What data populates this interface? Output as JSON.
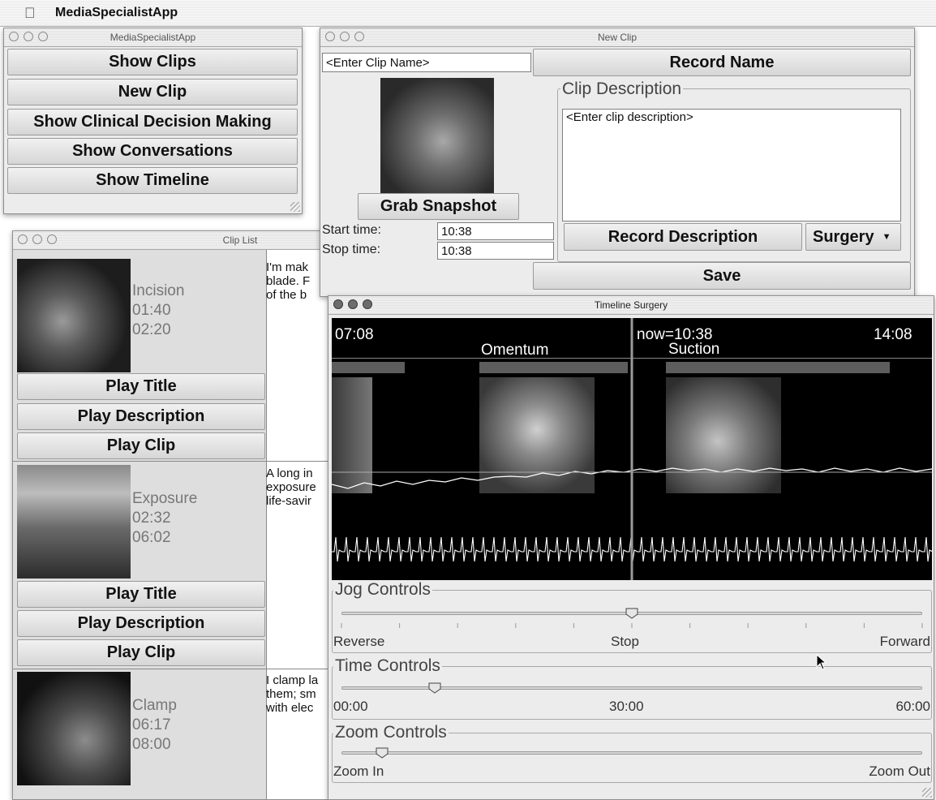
{
  "menubar": {
    "app_name": "MediaSpecialistApp"
  },
  "main_window": {
    "title": "MediaSpecialistApp",
    "buttons": [
      "Show Clips",
      "New Clip",
      "Show Clinical Decision Making",
      "Show Conversations",
      "Show Timeline"
    ]
  },
  "new_clip": {
    "title": "New Clip",
    "name_value": "<Enter Clip Name>",
    "record_name_label": "Record Name",
    "description_group_label": "Clip Description",
    "description_value": "<Enter clip description>",
    "grab_snapshot_label": "Grab Snapshot",
    "start_label": "Start time:",
    "start_value": "10:38",
    "stop_label": "Stop time:",
    "stop_value": "10:38",
    "record_description_label": "Record Description",
    "category_value": "Surgery",
    "save_label": "Save"
  },
  "clip_list": {
    "title": "Clip List",
    "play_title_label": "Play Title",
    "play_description_label": "Play Description",
    "play_clip_label": "Play Clip",
    "clips": [
      {
        "name": "Incision",
        "start": "01:40",
        "stop": "02:20",
        "text": "I'm mak\nblade. F\nof the b"
      },
      {
        "name": "Exposure",
        "start": "02:32",
        "stop": "06:02",
        "text": "A long in\nexposure\nlife-savir"
      },
      {
        "name": "Clamp",
        "start": "06:17",
        "stop": "08:00",
        "text": "I clamp la\nthem; sm\nwith elec"
      }
    ]
  },
  "timeline": {
    "title": "Timeline Surgery",
    "start_time": "07:08",
    "now_label": "now=10:38",
    "end_time": "14:08",
    "segment_left": "Omentum",
    "segment_right": "Suction",
    "jog": {
      "label": "Jog Controls",
      "reverse": "Reverse",
      "stop": "Stop",
      "forward": "Forward",
      "position": 0.5
    },
    "time": {
      "label": "Time Controls",
      "min": "00:00",
      "mid": "30:00",
      "max": "60:00",
      "position": 0.16
    },
    "zoom": {
      "label": "Zoom Controls",
      "zoom_in": "Zoom In",
      "zoom_out": "Zoom Out",
      "position": 0.07
    }
  }
}
